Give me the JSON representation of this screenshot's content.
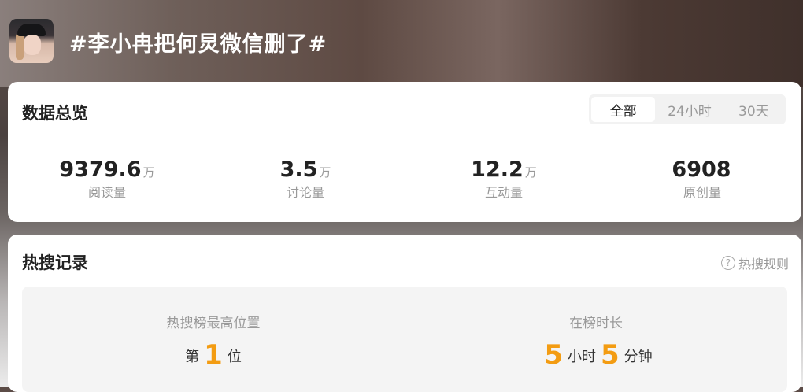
{
  "header": {
    "topic": "#李小冉把何炅微信删了#",
    "avatar_label": "avatar"
  },
  "overview": {
    "title": "数据总览",
    "tabs": [
      {
        "label": "全部",
        "active": true
      },
      {
        "label": "24小时",
        "active": false
      },
      {
        "label": "30天",
        "active": false
      }
    ],
    "stats": [
      {
        "value": "9379.6",
        "unit": "万",
        "label": "阅读量"
      },
      {
        "value": "3.5",
        "unit": "万",
        "label": "讨论量"
      },
      {
        "value": "12.2",
        "unit": "万",
        "label": "互动量"
      },
      {
        "value": "6908",
        "unit": "",
        "label": "原创量"
      }
    ]
  },
  "hot": {
    "title": "热搜记录",
    "rules_label": "热搜规则",
    "rules_icon": "?",
    "best_rank": {
      "title": "热搜榜最高位置",
      "prefix": "第",
      "value": "1",
      "suffix": "位"
    },
    "duration": {
      "title": "在榜时长",
      "hours": "5",
      "hours_unit": "小时",
      "minutes": "5",
      "minutes_unit": "分钟"
    }
  },
  "colors": {
    "accent": "#f39c12"
  }
}
